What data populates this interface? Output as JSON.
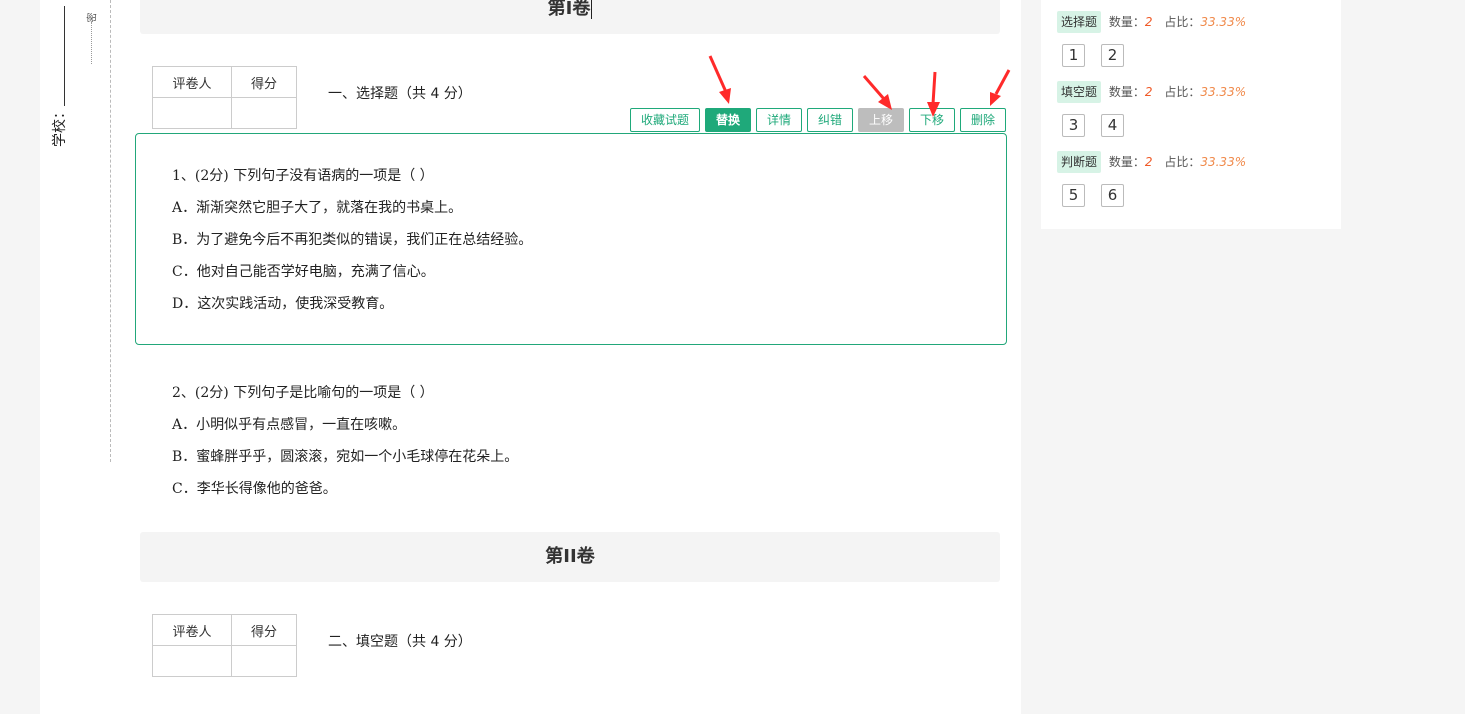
{
  "binding": {
    "school_label": "学校：",
    "mark": "密"
  },
  "volume1": {
    "title": "第I卷"
  },
  "volume2": {
    "title": "第II卷"
  },
  "grade_table": {
    "grader": "评卷人",
    "score": "得分"
  },
  "section1": {
    "title": "一、选择题（共 4 分）"
  },
  "section2": {
    "title": "二、填空题（共 4 分）"
  },
  "toolbar": {
    "collect": "收藏试题",
    "replace": "替换",
    "details": "详情",
    "correct": "纠错",
    "move_up": "上移",
    "move_down": "下移",
    "delete": "删除"
  },
  "questions": [
    {
      "stem": "1、(2分) 下列句子没有语病的一项是（        ）",
      "options": [
        "A．渐渐突然它胆子大了，就落在我的书桌上。",
        "B．为了避免今后不再犯类似的错误，我们正在总结经验。",
        "C．他对自己能否学好电脑，充满了信心。",
        "D．这次实践活动，使我深受教育。"
      ]
    },
    {
      "stem": "2、(2分) 下列句子是比喻句的一项是（        ）",
      "options": [
        "A．小明似乎有点感冒，一直在咳嗽。",
        "B．蜜蜂胖乎乎，圆滚滚，宛如一个小毛球停在花朵上。",
        "C．李华长得像他的爸爸。"
      ]
    }
  ],
  "side_panel": {
    "categories": [
      {
        "name": "选择题",
        "count_label": "数量：",
        "count": "2",
        "ratio_label": "占比：",
        "ratio": "33.33%",
        "numbers": [
          "1",
          "2"
        ]
      },
      {
        "name": "填空题",
        "count_label": "数量：",
        "count": "2",
        "ratio_label": "占比：",
        "ratio": "33.33%",
        "numbers": [
          "3",
          "4"
        ]
      },
      {
        "name": "判断题",
        "count_label": "数量：",
        "count": "2",
        "ratio_label": "占比：",
        "ratio": "33.33%",
        "numbers": [
          "5",
          "6"
        ]
      }
    ]
  },
  "colors": {
    "accent": "#1fa97a",
    "arrow": "#ff2a2a",
    "ratio": "#f08a4b"
  }
}
